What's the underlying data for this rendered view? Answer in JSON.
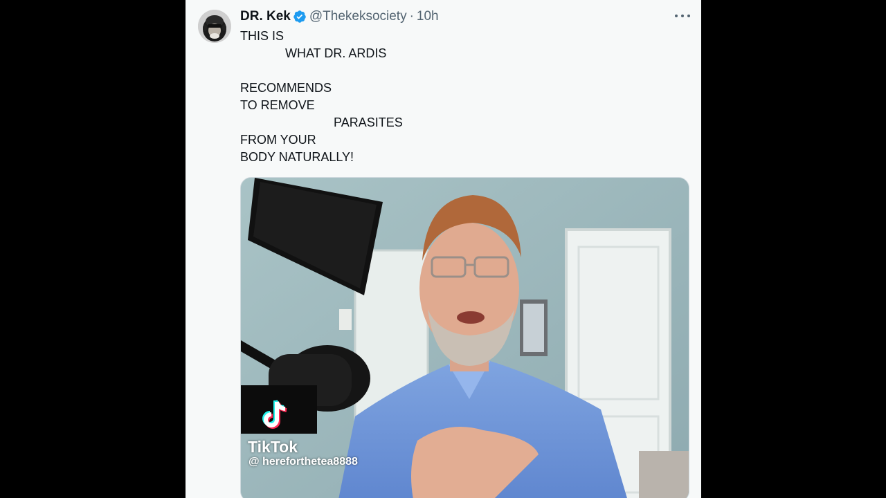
{
  "tweet": {
    "author_name": "DR. Kek",
    "author_handle": "@Thekeksociety",
    "separator": "·",
    "time": "10h",
    "text_lines": [
      "THIS IS",
      "             WHAT DR. ARDIS",
      "",
      "RECOMMENDS",
      "TO REMOVE",
      "                           PARASITES",
      "FROM YOUR",
      "BODY NATURALLY!"
    ]
  },
  "media": {
    "watermark_brand": "TikTok",
    "watermark_user": "@ herefortheteа8888"
  },
  "icons": {
    "verified": "verified-badge-icon",
    "more": "more-horizontal-icon",
    "tiktok": "tiktok-logo-icon"
  },
  "colors": {
    "verified_blue": "#1d9bf0",
    "text_primary": "#0f1419",
    "text_secondary": "#536471",
    "card_bg": "#f7f9f9",
    "outer_bg": "#000000"
  }
}
